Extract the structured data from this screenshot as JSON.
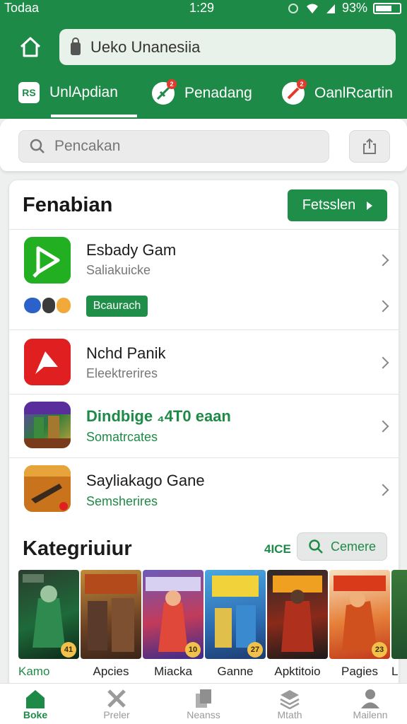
{
  "status": {
    "carrier": "Todaa",
    "time": "1:29",
    "battery": "93%"
  },
  "header": {
    "url": "Ueko Unanesiia",
    "tabs": [
      {
        "label": "UnlApdian",
        "badge": "RS"
      },
      {
        "label": "Penadang",
        "dot": "2"
      },
      {
        "label": "OanlRcartin",
        "dot": "2"
      }
    ]
  },
  "search": {
    "placeholder": "Pencakan"
  },
  "featured": {
    "title": "Fenabian",
    "button": "Fetsslen",
    "items": [
      {
        "name": "Esbady Gam",
        "sub": "Saliakuicke"
      },
      {
        "tag": "Bcaurach"
      },
      {
        "name": "Nchd Panik",
        "sub": "Eleektrerires"
      },
      {
        "name": "Dindbige  ₄4T0  eaan",
        "sub": "Somatrcates"
      },
      {
        "name": "Sayliakago Gane",
        "sub": "Semsherires"
      }
    ]
  },
  "categories": {
    "title": "Kategriuiur",
    "count": "4ICE",
    "button": "Cemere",
    "items": [
      {
        "label": "Kamo",
        "badge": "41"
      },
      {
        "label": "Apcies",
        "badge": ""
      },
      {
        "label": "Miacka",
        "badge": "10"
      },
      {
        "label": "Ganne",
        "badge": "27"
      },
      {
        "label": "Apktitoio",
        "badge": ""
      },
      {
        "label": "Pagies",
        "badge": "23"
      },
      {
        "label": "L",
        "badge": ""
      }
    ]
  },
  "bottom_nav": [
    {
      "label": "Boke"
    },
    {
      "label": "Preler"
    },
    {
      "label": "Neanss"
    },
    {
      "label": "Mtath"
    },
    {
      "label": "Mailenn"
    }
  ],
  "colors": {
    "primary": "#1e8a47",
    "accent_red": "#e23b2e"
  }
}
